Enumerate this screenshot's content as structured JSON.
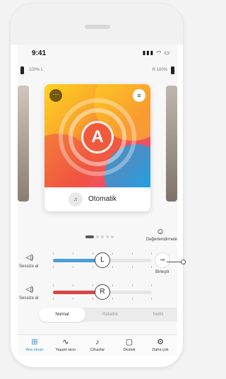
{
  "status": {
    "time": "9:41",
    "signal": "▍▌▋▉",
    "wifi": "◔",
    "battery": "▮"
  },
  "hearing_aids": {
    "left_battery": "100% L",
    "right_battery": "R  100%"
  },
  "program": {
    "badge_letter": "A",
    "name": "Otomatik",
    "menu_icon": "···",
    "settings_icon": "≡"
  },
  "pager": {
    "count": 5,
    "active_index": 0
  },
  "ratings": {
    "label": "Değerlendirmeler",
    "icon": "☺"
  },
  "mute": {
    "label": "Sessize al",
    "icon": "🔈"
  },
  "volume": {
    "left": {
      "thumb_label": "L",
      "level": 0.5,
      "color": "#4a9fd5"
    },
    "right": {
      "thumb_label": "R",
      "level": 0.5,
      "color": "#d84545"
    }
  },
  "merge": {
    "label": "Birleştir",
    "icon": "⊸"
  },
  "modes": {
    "items": [
      "Normal",
      "Rahatlık",
      "Netlik"
    ],
    "selected": 0
  },
  "nav": {
    "items": [
      {
        "label": "Ana ekran",
        "icon": "⊞"
      },
      {
        "label": "Yaşam tarzı",
        "icon": "∿"
      },
      {
        "label": "Cihazlar",
        "icon": "\u0001"
      },
      {
        "label": "Destek",
        "icon": "▢"
      },
      {
        "label": "Daha çok",
        "icon": "⚙"
      }
    ],
    "active": 0
  }
}
